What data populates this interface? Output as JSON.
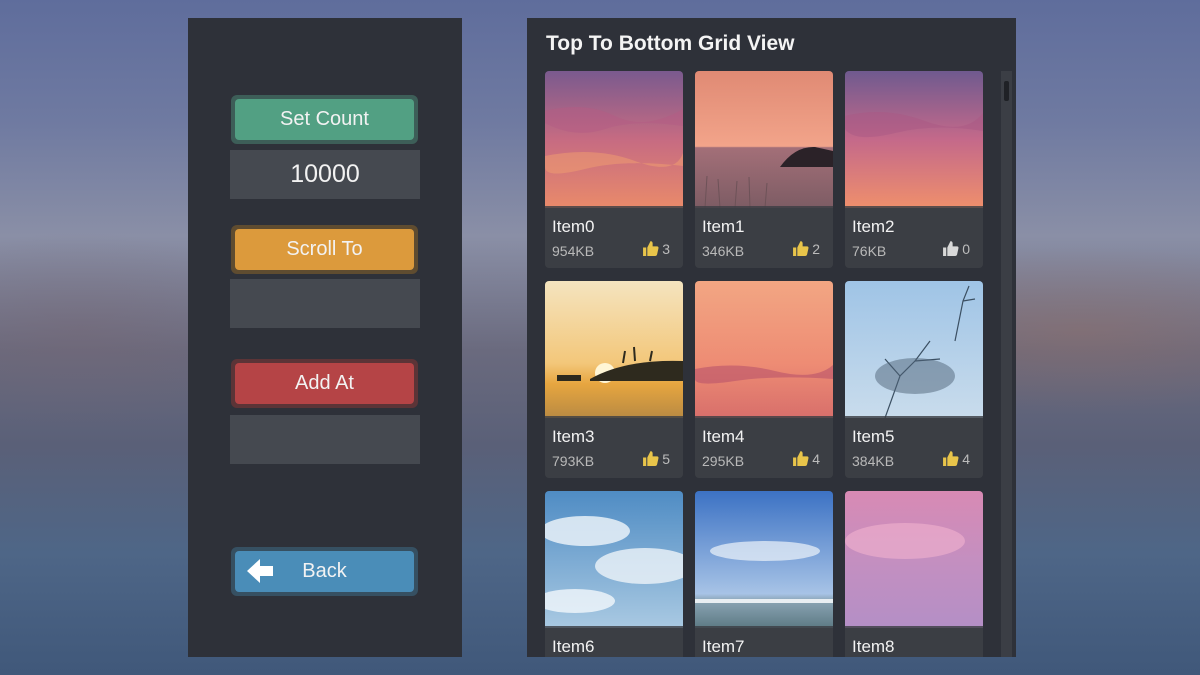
{
  "controls": {
    "set_count_label": "Set Count",
    "count_value": "10000",
    "scroll_to_label": "Scroll To",
    "scroll_to_value": "",
    "add_at_label": "Add At",
    "add_at_value": "",
    "back_label": "Back",
    "back_icon": "arrow-left-icon"
  },
  "grid": {
    "title": "Top To Bottom Grid View",
    "items": [
      {
        "name": "Item0",
        "size": "954KB",
        "likes": "3",
        "liked": true
      },
      {
        "name": "Item1",
        "size": "346KB",
        "likes": "2",
        "liked": true
      },
      {
        "name": "Item2",
        "size": "76KB",
        "likes": "0",
        "liked": false
      },
      {
        "name": "Item3",
        "size": "793KB",
        "likes": "5",
        "liked": true
      },
      {
        "name": "Item4",
        "size": "295KB",
        "likes": "4",
        "liked": true
      },
      {
        "name": "Item5",
        "size": "384KB",
        "likes": "4",
        "liked": true
      },
      {
        "name": "Item6",
        "size": "",
        "likes": "",
        "liked": true
      },
      {
        "name": "Item7",
        "size": "",
        "likes": "",
        "liked": true
      },
      {
        "name": "Item8",
        "size": "",
        "likes": "",
        "liked": true
      }
    ]
  },
  "colors": {
    "set_count": "#52a083",
    "scroll_to": "#dc9a3c",
    "add_at": "#b54446",
    "back": "#4a8db8",
    "like_active": "#e8c44a",
    "like_inactive": "#d8d8d8"
  }
}
